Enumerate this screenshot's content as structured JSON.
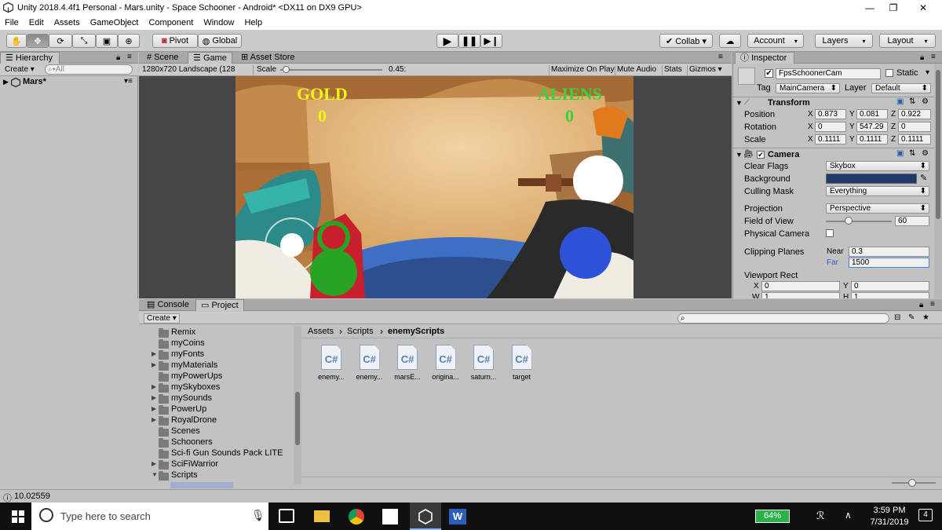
{
  "window": {
    "title": "Unity 2018.4.4f1 Personal - Mars.unity - Space Schooner - Android* <DX11 on DX9 GPU>",
    "minimize": "—",
    "maximize": "❐",
    "close": "✕"
  },
  "menu": [
    "File",
    "Edit",
    "Assets",
    "GameObject",
    "Component",
    "Window",
    "Help"
  ],
  "toolbar": {
    "pivot": "Pivot",
    "global": "Global",
    "collab": "Collab ▾",
    "account": "Account",
    "layers": "Layers",
    "layout": "Layout"
  },
  "hierarchy": {
    "tab": "Hierarchy",
    "create": "Create",
    "search_placeholder": "All",
    "root": "Mars*"
  },
  "center_tabs": {
    "scene": "Scene",
    "game": "Game",
    "asset_store": "Asset Store"
  },
  "game_bar": {
    "resolution": "1280x720 Landscape (128",
    "scale_label": "Scale",
    "scale_value": "0.45:",
    "scale_level": 0.05,
    "maximize": "Maximize On Play",
    "mute": "Mute Audio",
    "stats": "Stats",
    "gizmos": "Gizmos"
  },
  "game_hud": {
    "gold_label": "GOLD",
    "gold_value": "0",
    "aliens_label": "ALIENS",
    "aliens_value": "0",
    "gold_color": "#f2f21a",
    "aliens_color": "#3ad23a"
  },
  "inspector": {
    "tab": "Inspector",
    "object_name": "FpsSchoonerCam",
    "static": "Static",
    "tag_label": "Tag",
    "tag": "MainCamera",
    "layer_label": "Layer",
    "layer": "Default",
    "transform": {
      "title": "Transform",
      "position_label": "Position",
      "rotation_label": "Rotation",
      "scale_label": "Scale",
      "position": [
        "0.873",
        "0.081",
        "0.922"
      ],
      "rotation": [
        "0",
        "547.29",
        "0"
      ],
      "scale": [
        "0.1111",
        "0.1111",
        "0.1111"
      ]
    },
    "camera": {
      "title": "Camera",
      "clear_flags_label": "Clear Flags",
      "clear_flags": "Skybox",
      "background_label": "Background",
      "background_color": "#1d3a6b",
      "culling_label": "Culling Mask",
      "culling": "Everything",
      "projection_label": "Projection",
      "projection": "Perspective",
      "fov_label": "Field of View",
      "fov": "60",
      "fov_level": 0.34,
      "physical_label": "Physical Camera",
      "clipping_label": "Clipping Planes",
      "near_label": "Near",
      "near": "0.3",
      "far_label": "Far",
      "far": "1500",
      "viewport_label": "Viewport Rect",
      "vx": "0",
      "vy": "0",
      "vw": "1",
      "vh": "1"
    }
  },
  "bottom_tabs": {
    "console": "Console",
    "project": "Project"
  },
  "project": {
    "create": "Create",
    "tree": [
      {
        "name": "Remix",
        "arrow": ""
      },
      {
        "name": "myCoins",
        "arrow": ""
      },
      {
        "name": "myFonts",
        "arrow": "▶"
      },
      {
        "name": "myMaterials",
        "arrow": "▶"
      },
      {
        "name": "myPowerUps",
        "arrow": ""
      },
      {
        "name": "mySkyboxes",
        "arrow": "▶"
      },
      {
        "name": "mySounds",
        "arrow": "▶"
      },
      {
        "name": "PowerUp",
        "arrow": "▶"
      },
      {
        "name": "RoyalDrone",
        "arrow": "▶"
      },
      {
        "name": "Scenes",
        "arrow": ""
      },
      {
        "name": "Schooners",
        "arrow": ""
      },
      {
        "name": "Sci-fi Gun Sounds Pack LITE",
        "arrow": ""
      },
      {
        "name": "SciFiWarrior",
        "arrow": "▶"
      },
      {
        "name": "Scripts",
        "arrow": "▼"
      }
    ],
    "breadcrumb": [
      "Assets",
      "Scripts",
      "enemyScripts"
    ],
    "sep": "›",
    "assets": [
      "enemy...",
      "enemy...",
      "marsE...",
      "origina...",
      "saturn...",
      "target"
    ],
    "asset_icon": "C#"
  },
  "status": {
    "text": "10.02559"
  },
  "taskbar": {
    "search_placeholder": "Type here to search",
    "battery": "64%",
    "time": "3:59 PM",
    "date": "7/31/2019",
    "notif": "4"
  }
}
